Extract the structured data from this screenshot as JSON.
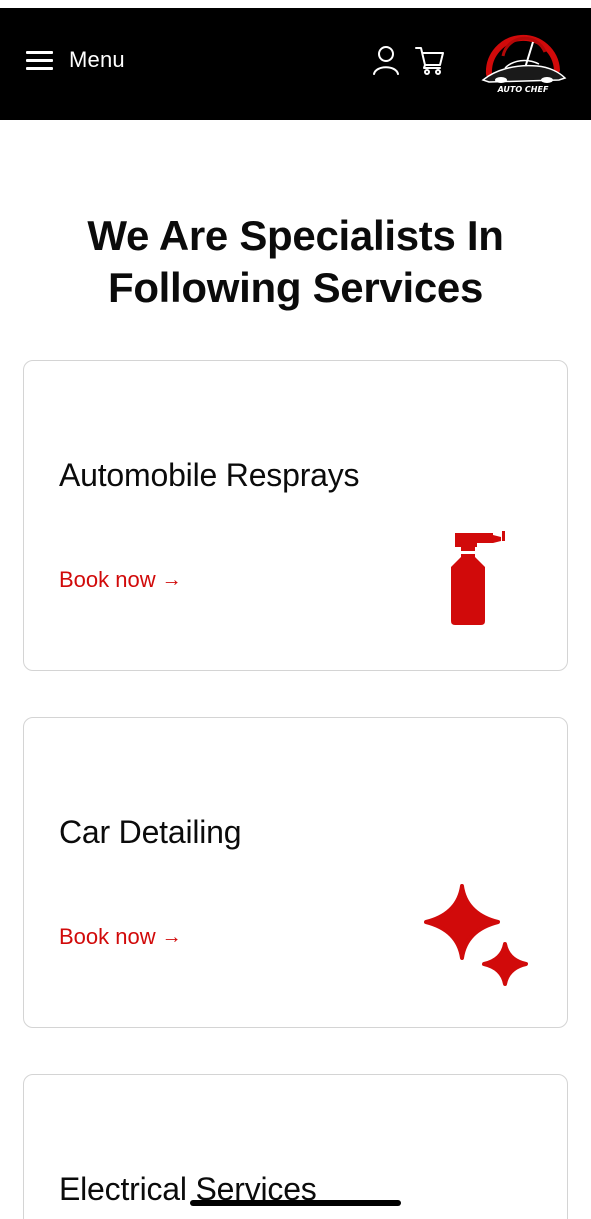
{
  "header": {
    "menu_label": "Menu",
    "logo_text": "AUTO CHEF",
    "colors": {
      "background": "#000000",
      "text": "#ffffff",
      "accent": "#d10a0a"
    },
    "icons": [
      "hamburger-icon",
      "account-icon",
      "cart-icon"
    ]
  },
  "main": {
    "heading_line1": "We Are Specialists In",
    "heading_line2": "Following Services",
    "services": [
      {
        "title": "Automobile Resprays",
        "link_label": "Book now",
        "arrow": "→",
        "icon": "spray-bottle-icon"
      },
      {
        "title": "Car Detailing",
        "link_label": "Book now",
        "arrow": "→",
        "icon": "sparkle-icon"
      },
      {
        "title": "Electrical Services"
      }
    ]
  }
}
